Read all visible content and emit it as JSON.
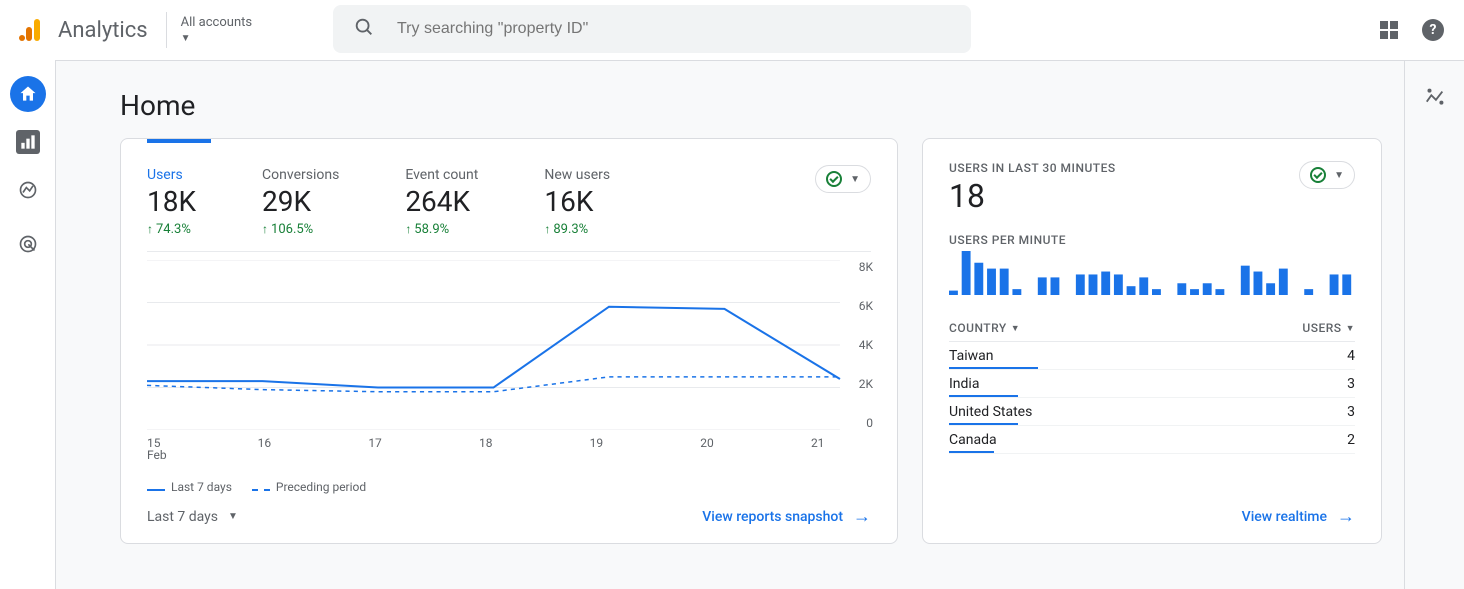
{
  "header": {
    "brand": "Analytics",
    "accounts_label": "All accounts",
    "search_placeholder": "Try searching \"property ID\""
  },
  "page": {
    "title": "Home"
  },
  "overview": {
    "kpis": [
      {
        "label": "Users",
        "value": "18K",
        "delta": "74.3%",
        "active": true
      },
      {
        "label": "Conversions",
        "value": "29K",
        "delta": "106.5%",
        "active": false
      },
      {
        "label": "Event count",
        "value": "264K",
        "delta": "58.9%",
        "active": false
      },
      {
        "label": "New users",
        "value": "16K",
        "delta": "89.3%",
        "active": false
      }
    ],
    "range_label": "Last 7 days",
    "legend_current": "Last 7 days",
    "legend_prev": "Preceding period",
    "footer_link": "View reports snapshot",
    "x_month": "Feb"
  },
  "chart_data": {
    "type": "line",
    "xlabel": "",
    "ylabel": "",
    "ylim": [
      0,
      8000
    ],
    "y_ticks": [
      "8K",
      "6K",
      "4K",
      "2K",
      "0"
    ],
    "categories": [
      "15",
      "16",
      "17",
      "18",
      "19",
      "20",
      "21"
    ],
    "series": [
      {
        "name": "Last 7 days",
        "values": [
          2300,
          2300,
          2000,
          2000,
          5800,
          5700,
          2400
        ]
      },
      {
        "name": "Preceding period",
        "values": [
          2100,
          1900,
          1800,
          1800,
          2500,
          2500,
          2500
        ]
      }
    ]
  },
  "realtime": {
    "title": "USERS IN LAST 30 MINUTES",
    "value": "18",
    "subtitle": "USERS PER MINUTE",
    "spark_values": [
      3,
      30,
      22,
      18,
      18,
      4,
      0,
      12,
      12,
      0,
      14,
      14,
      16,
      14,
      6,
      12,
      4,
      0,
      8,
      4,
      8,
      4,
      0,
      20,
      16,
      8,
      18,
      0,
      4,
      0,
      14,
      14
    ],
    "cols": {
      "country": "COUNTRY",
      "users": "USERS"
    },
    "rows": [
      {
        "country": "Taiwan",
        "users": "4",
        "bar_pct": 22
      },
      {
        "country": "India",
        "users": "3",
        "bar_pct": 17
      },
      {
        "country": "United States",
        "users": "3",
        "bar_pct": 17
      },
      {
        "country": "Canada",
        "users": "2",
        "bar_pct": 11
      }
    ],
    "footer_link": "View realtime"
  }
}
